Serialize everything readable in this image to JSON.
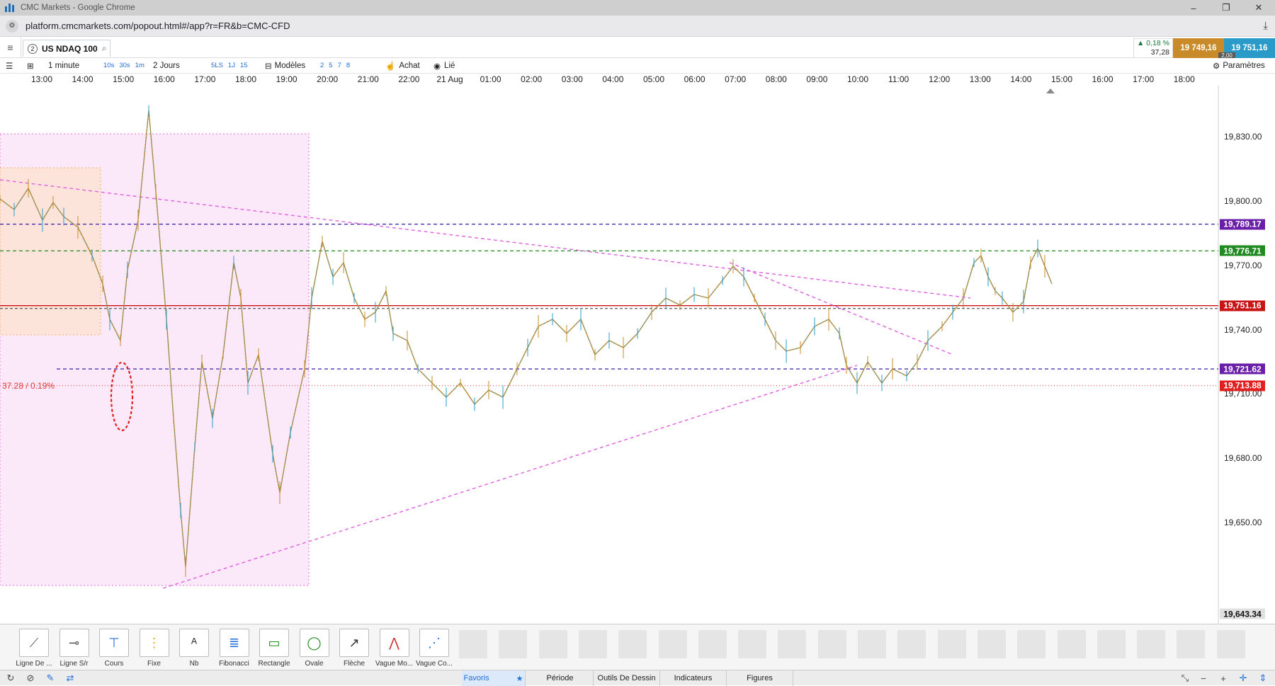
{
  "window": {
    "title": "CMC Markets - Google Chrome",
    "minimize": "–",
    "restore": "❐",
    "close": "✕"
  },
  "browser": {
    "url": "platform.cmcmarkets.com/popout.html#/app?r=FR&b=CMC-CFD"
  },
  "instrument": {
    "tab_number": "2",
    "name": "US NDAQ 100"
  },
  "quote": {
    "change_pct": "0,18 %",
    "change_abs": "37,28",
    "bid": "19 749,16",
    "ask": "19 751,16",
    "spread": "2,00",
    "change_direction": "up"
  },
  "toolbar": {
    "interval": "1 minute",
    "intervals": [
      "10s",
      "30s",
      "1m"
    ],
    "range": "2 Jours",
    "range_shortcuts": [
      "5LS",
      "1J",
      "15"
    ],
    "templates_label": "Modèles",
    "template_slots": [
      "2",
      "5",
      "7",
      "8"
    ],
    "achat_label": "Achat",
    "lie_label": "Lié",
    "settings_label": "Paramètres"
  },
  "time_axis": [
    "13:00",
    "14:00",
    "15:00",
    "16:00",
    "17:00",
    "18:00",
    "19:00",
    "20:00",
    "21:00",
    "22:00",
    "21 Aug",
    "01:00",
    "02:00",
    "03:00",
    "04:00",
    "05:00",
    "06:00",
    "07:00",
    "08:00",
    "09:00",
    "10:00",
    "11:00",
    "12:00",
    "13:00",
    "14:00",
    "15:00",
    "16:00",
    "17:00",
    "18:00"
  ],
  "price_axis": [
    "19,830.00",
    "19,800.00",
    "19,770.00",
    "19,740.00",
    "19,710.00",
    "19,680.00",
    "19,650.00"
  ],
  "price_labels": [
    {
      "text": "19,789.17",
      "color": "#6b1fa8"
    },
    {
      "text": "19,776.71",
      "color": "#1f8a1f"
    },
    {
      "text": "19,751.16",
      "color": "#c81414"
    },
    {
      "text": "19,721.62",
      "color": "#6b1fa8"
    },
    {
      "text": "19,713.88",
      "color": "#e02020"
    },
    {
      "text": "19,643.34",
      "color": "#ffffff"
    }
  ],
  "pnl_label": "37.28 / 0.19%",
  "drawing_tools": [
    {
      "label": "Ligne De ...",
      "icon": "trend-line-icon"
    },
    {
      "label": "Ligne S/r",
      "icon": "sr-line-icon"
    },
    {
      "label": "Cours",
      "icon": "price-level-icon"
    },
    {
      "label": "Fixe",
      "icon": "fixed-line-icon"
    },
    {
      "label": "Nb",
      "icon": "text-note-icon"
    },
    {
      "label": "Fibonacci",
      "icon": "fibonacci-icon"
    },
    {
      "label": "Rectangle",
      "icon": "rectangle-icon"
    },
    {
      "label": "Ovale",
      "icon": "oval-icon"
    },
    {
      "label": "Flèche",
      "icon": "arrow-icon"
    },
    {
      "label": "Vague Mo...",
      "icon": "wave-motive-icon"
    },
    {
      "label": "Vague Co...",
      "icon": "wave-corrective-icon"
    }
  ],
  "bottom_tabs": [
    "Favoris",
    "Période",
    "Outils De Dessin",
    "Indicateurs",
    "Figures"
  ],
  "colors": {
    "bid": "#c98b2a",
    "ask": "#2a9bc8",
    "up_candle": "#2a9bc8",
    "down_candle": "#c98b2a",
    "highlight_pink": "#f7d6f3",
    "highlight_orange": "#fde2cf"
  }
}
